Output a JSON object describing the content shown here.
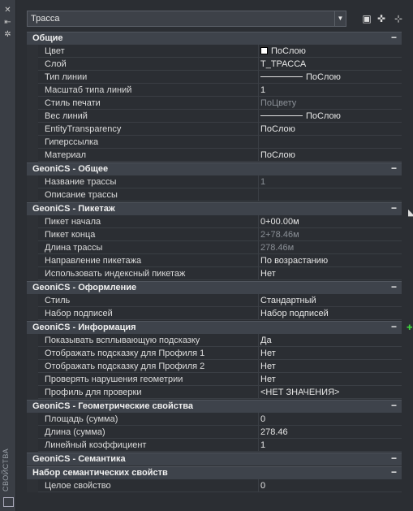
{
  "window": {
    "side_title": "СВОЙСТВА"
  },
  "selector": {
    "value": "Трасса"
  },
  "categories": [
    {
      "title": "Общие",
      "toggle": "−",
      "rows": [
        {
          "label": "Цвет",
          "value": "ПоСлою",
          "swatch": "#ffffff"
        },
        {
          "label": "Слой",
          "value": "Т_ТРАССА"
        },
        {
          "label": "Тип линии",
          "value": "ПоСлою",
          "line": true
        },
        {
          "label": "Масштаб типа линий",
          "value": "1"
        },
        {
          "label": "Стиль печати",
          "value": "ПоЦвету",
          "dim": true
        },
        {
          "label": "Вес линий",
          "value": "ПоСлою",
          "line": true
        },
        {
          "label": "EntityTransparency",
          "value": "ПоСлою"
        },
        {
          "label": "Гиперссылка",
          "value": ""
        },
        {
          "label": "Материал",
          "value": "ПоСлою"
        }
      ]
    },
    {
      "title": "GeoniCS - Общее",
      "toggle": "−",
      "rows": [
        {
          "label": "Название трассы",
          "value": "1",
          "dim": true
        },
        {
          "label": "Описание трассы",
          "value": ""
        }
      ]
    },
    {
      "title": "GeoniCS - Пикетаж",
      "toggle": "−",
      "rows": [
        {
          "label": "Пикет начала",
          "value": "0+00.00м"
        },
        {
          "label": "Пикет конца",
          "value": "2+78.46м",
          "dim": true
        },
        {
          "label": "Длина трассы",
          "value": "278.46м",
          "dim": true
        },
        {
          "label": "Направление пикетажа",
          "value": "По возрастанию"
        },
        {
          "label": "Использовать индексный пикетаж",
          "value": "Нет"
        }
      ]
    },
    {
      "title": "GeoniCS - Оформление",
      "toggle": "−",
      "rows": [
        {
          "label": "Стиль",
          "value": "Стандартный"
        },
        {
          "label": "Набор подписей",
          "value": "Набор подписей"
        }
      ]
    },
    {
      "title": "GeoniCS - Информация",
      "toggle": "−",
      "rows": [
        {
          "label": "Показывать всплывающую подсказку",
          "value": "Да"
        },
        {
          "label": "Отображать подсказку для Профиля 1",
          "value": "Нет"
        },
        {
          "label": "Отображать подсказку для Профиля 2",
          "value": "Нет"
        },
        {
          "label": "Проверять нарушения геометрии",
          "value": "Нет"
        },
        {
          "label": "Профиль для проверки",
          "value": "<НЕТ ЗНАЧЕНИЯ>"
        }
      ]
    },
    {
      "title": "GeoniCS - Геометрические свойства",
      "toggle": "−",
      "rows": [
        {
          "label": "Площадь (сумма)",
          "value": "0"
        },
        {
          "label": "Длина (сумма)",
          "value": "278.46"
        },
        {
          "label": "Линейный коэффициент",
          "value": "1"
        }
      ]
    },
    {
      "title": "GeoniCS - Семантика",
      "toggle": "−",
      "rows": []
    },
    {
      "title": "Набор семантических свойств",
      "toggle": "−",
      "rows": [
        {
          "label": "Целое свойство",
          "value": "0"
        }
      ]
    }
  ]
}
